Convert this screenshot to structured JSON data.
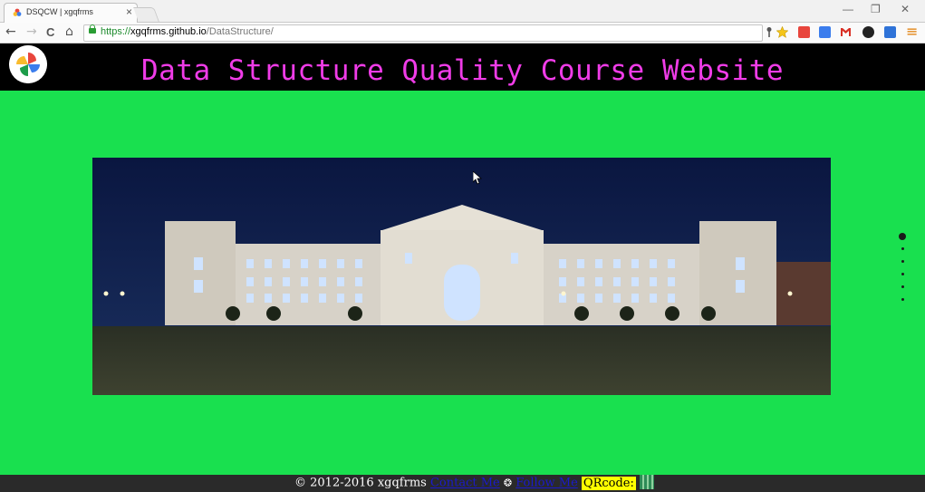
{
  "browser": {
    "tab_title": "DSQCW | xgqfrms",
    "tab_close": "×",
    "controls": {
      "minimize": "—",
      "restore": "❐",
      "close": "✕"
    },
    "nav": {
      "back": "←",
      "forward": "→",
      "reload": "C",
      "home": "⌂"
    },
    "url_scheme": "https://",
    "url_host": "xgqfrms.github.io",
    "url_path": "/DataStructure/",
    "extension_icons": [
      "key-icon",
      "star-icon",
      "red-extension-icon",
      "translate-icon",
      "gmail-icon",
      "dark-circle-icon",
      "blue-extension-icon",
      "menu-icon"
    ],
    "menu_glyph": "≡"
  },
  "page": {
    "title": "Data Structure Quality Course Website",
    "title_color": "#f03ce8",
    "background_color": "#19e04f",
    "slider": {
      "slide_count": 6,
      "active_index": 0
    },
    "footer": {
      "copyright": "© 2012-2016 xgqfrms",
      "contact_link": "Contact Me",
      "follow_link": "Follow Me",
      "qr_label": "QRcode:"
    }
  }
}
